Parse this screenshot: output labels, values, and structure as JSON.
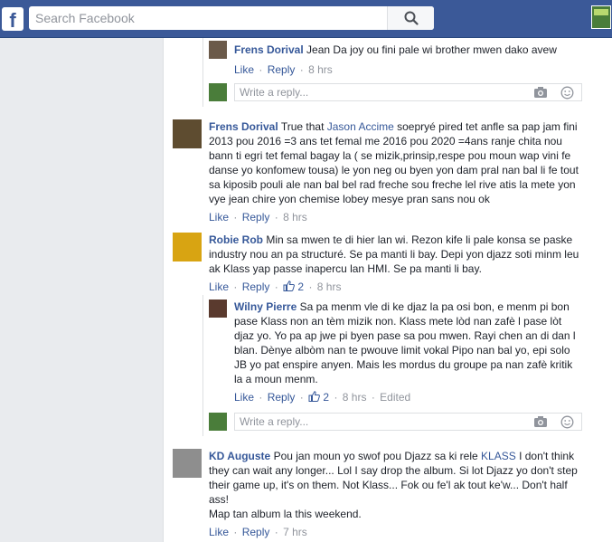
{
  "header": {
    "logo": "f",
    "search_placeholder": "Search Facebook",
    "icons": [
      "search-icon",
      "profile-avatar"
    ]
  },
  "reply_placeholder": "Write a reply...",
  "actions": {
    "like": "Like",
    "reply": "Reply",
    "dot": "·"
  },
  "comments": [
    {
      "name": "Frens Dorival",
      "text": "Jean Da joy ou fini pale wi brother mwen dako avew",
      "time": "8 hrs"
    },
    {
      "name": "Frens Dorival",
      "lines": [
        {
          "pre": "True that ",
          "mention": "Jason Accime",
          "post": " soepryé pired tet anfle sa pap jam fini"
        },
        {
          "text": "2013 pou 2016 =3 ans tet femal me 2016 pou 2020 =4ans ranje chita nou"
        },
        {
          "text": "bann ti egri tet femal bagay la ( se mizik,prinsip,respe pou moun wap vini fe"
        },
        {
          "text": "danse yo konfomew tousa) le yon neg ou byen yon dam pral nan bal li fe tout"
        },
        {
          "text": "sa kiposib pouli ale nan bal bel rad freche sou freche lel rive atis la mete yon"
        },
        {
          "text": "vye jean chire yon chemise lobey mesye pran sans nou ok"
        }
      ],
      "time": "8 hrs"
    },
    {
      "name": "Robie Rob",
      "lines": [
        {
          "text": "Min sa mwen te di hier lan wi. Rezon kife li pale konsa se paske"
        },
        {
          "text": "industry nou an pa structuré. Se pa manti li bay. Depi yon djazz soti minm leu"
        },
        {
          "text": "ak Klass yap passe inapercu lan HMI. Se pa manti li bay."
        }
      ],
      "likes": "2",
      "time": "8 hrs"
    },
    {
      "name": "Wilny Pierre",
      "lines": [
        {
          "text": "Sa pa menm vle di ke djaz la pa osi bon, e menm pi bon"
        },
        {
          "text": "pase Klass non an tèm mizik non. Klass mete lòd nan zafè l pase lòt"
        },
        {
          "text": "djaz yo. Yo pa ap jwe pi byen pase sa pou mwen. Rayi chen an di dan l"
        },
        {
          "text": "blan. Dènye albòm nan te pwouve limit vokal Pipo nan bal yo, epi solo"
        },
        {
          "text": "JB yo pat enspire anyen. Mais les mordus du groupe pa nan zafè kritik"
        },
        {
          "text": "la a moun menm."
        }
      ],
      "likes": "2",
      "time": "8 hrs",
      "edited": "Edited"
    },
    {
      "name": "KD Auguste",
      "lines": [
        {
          "pre": "Pou jan moun yo swof pou Djazz sa ki rele ",
          "mention": "KLASS",
          "post": " I don't think"
        },
        {
          "text": "they can wait any longer... Lol I say drop the album. Si lot Djazz yo don't step"
        },
        {
          "text": "their game up, it's on them. Not Klass... Fok ou fe'l ak tout ke'w... Don't half"
        },
        {
          "text": "ass!"
        },
        {
          "text": "Map tan album la this weekend."
        }
      ],
      "time": "7 hrs"
    }
  ]
}
